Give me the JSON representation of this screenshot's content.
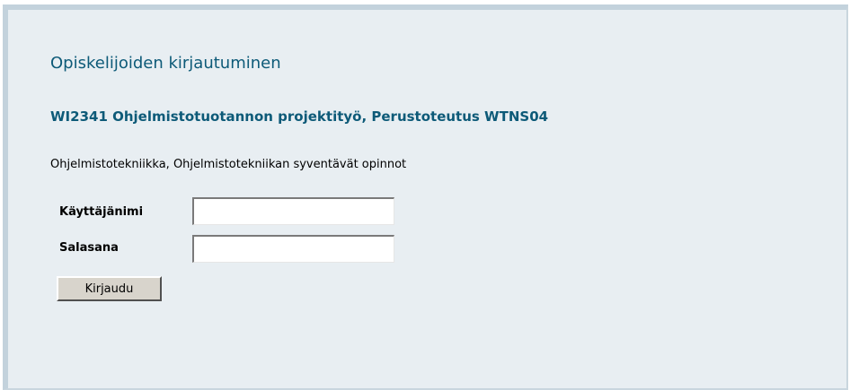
{
  "login": {
    "title": "Opiskelijoiden kirjautuminen",
    "course": "WI2341 Ohjelmistotuotannon projektityö, Perustoteutus WTNS04",
    "program": "Ohjelmistotekniikka, Ohjelmistotekniikan syventävät opinnot",
    "username_label": "Käyttäjänimi",
    "username_value": "",
    "password_label": "Salasana",
    "password_value": "",
    "submit_label": "Kirjaudu"
  }
}
